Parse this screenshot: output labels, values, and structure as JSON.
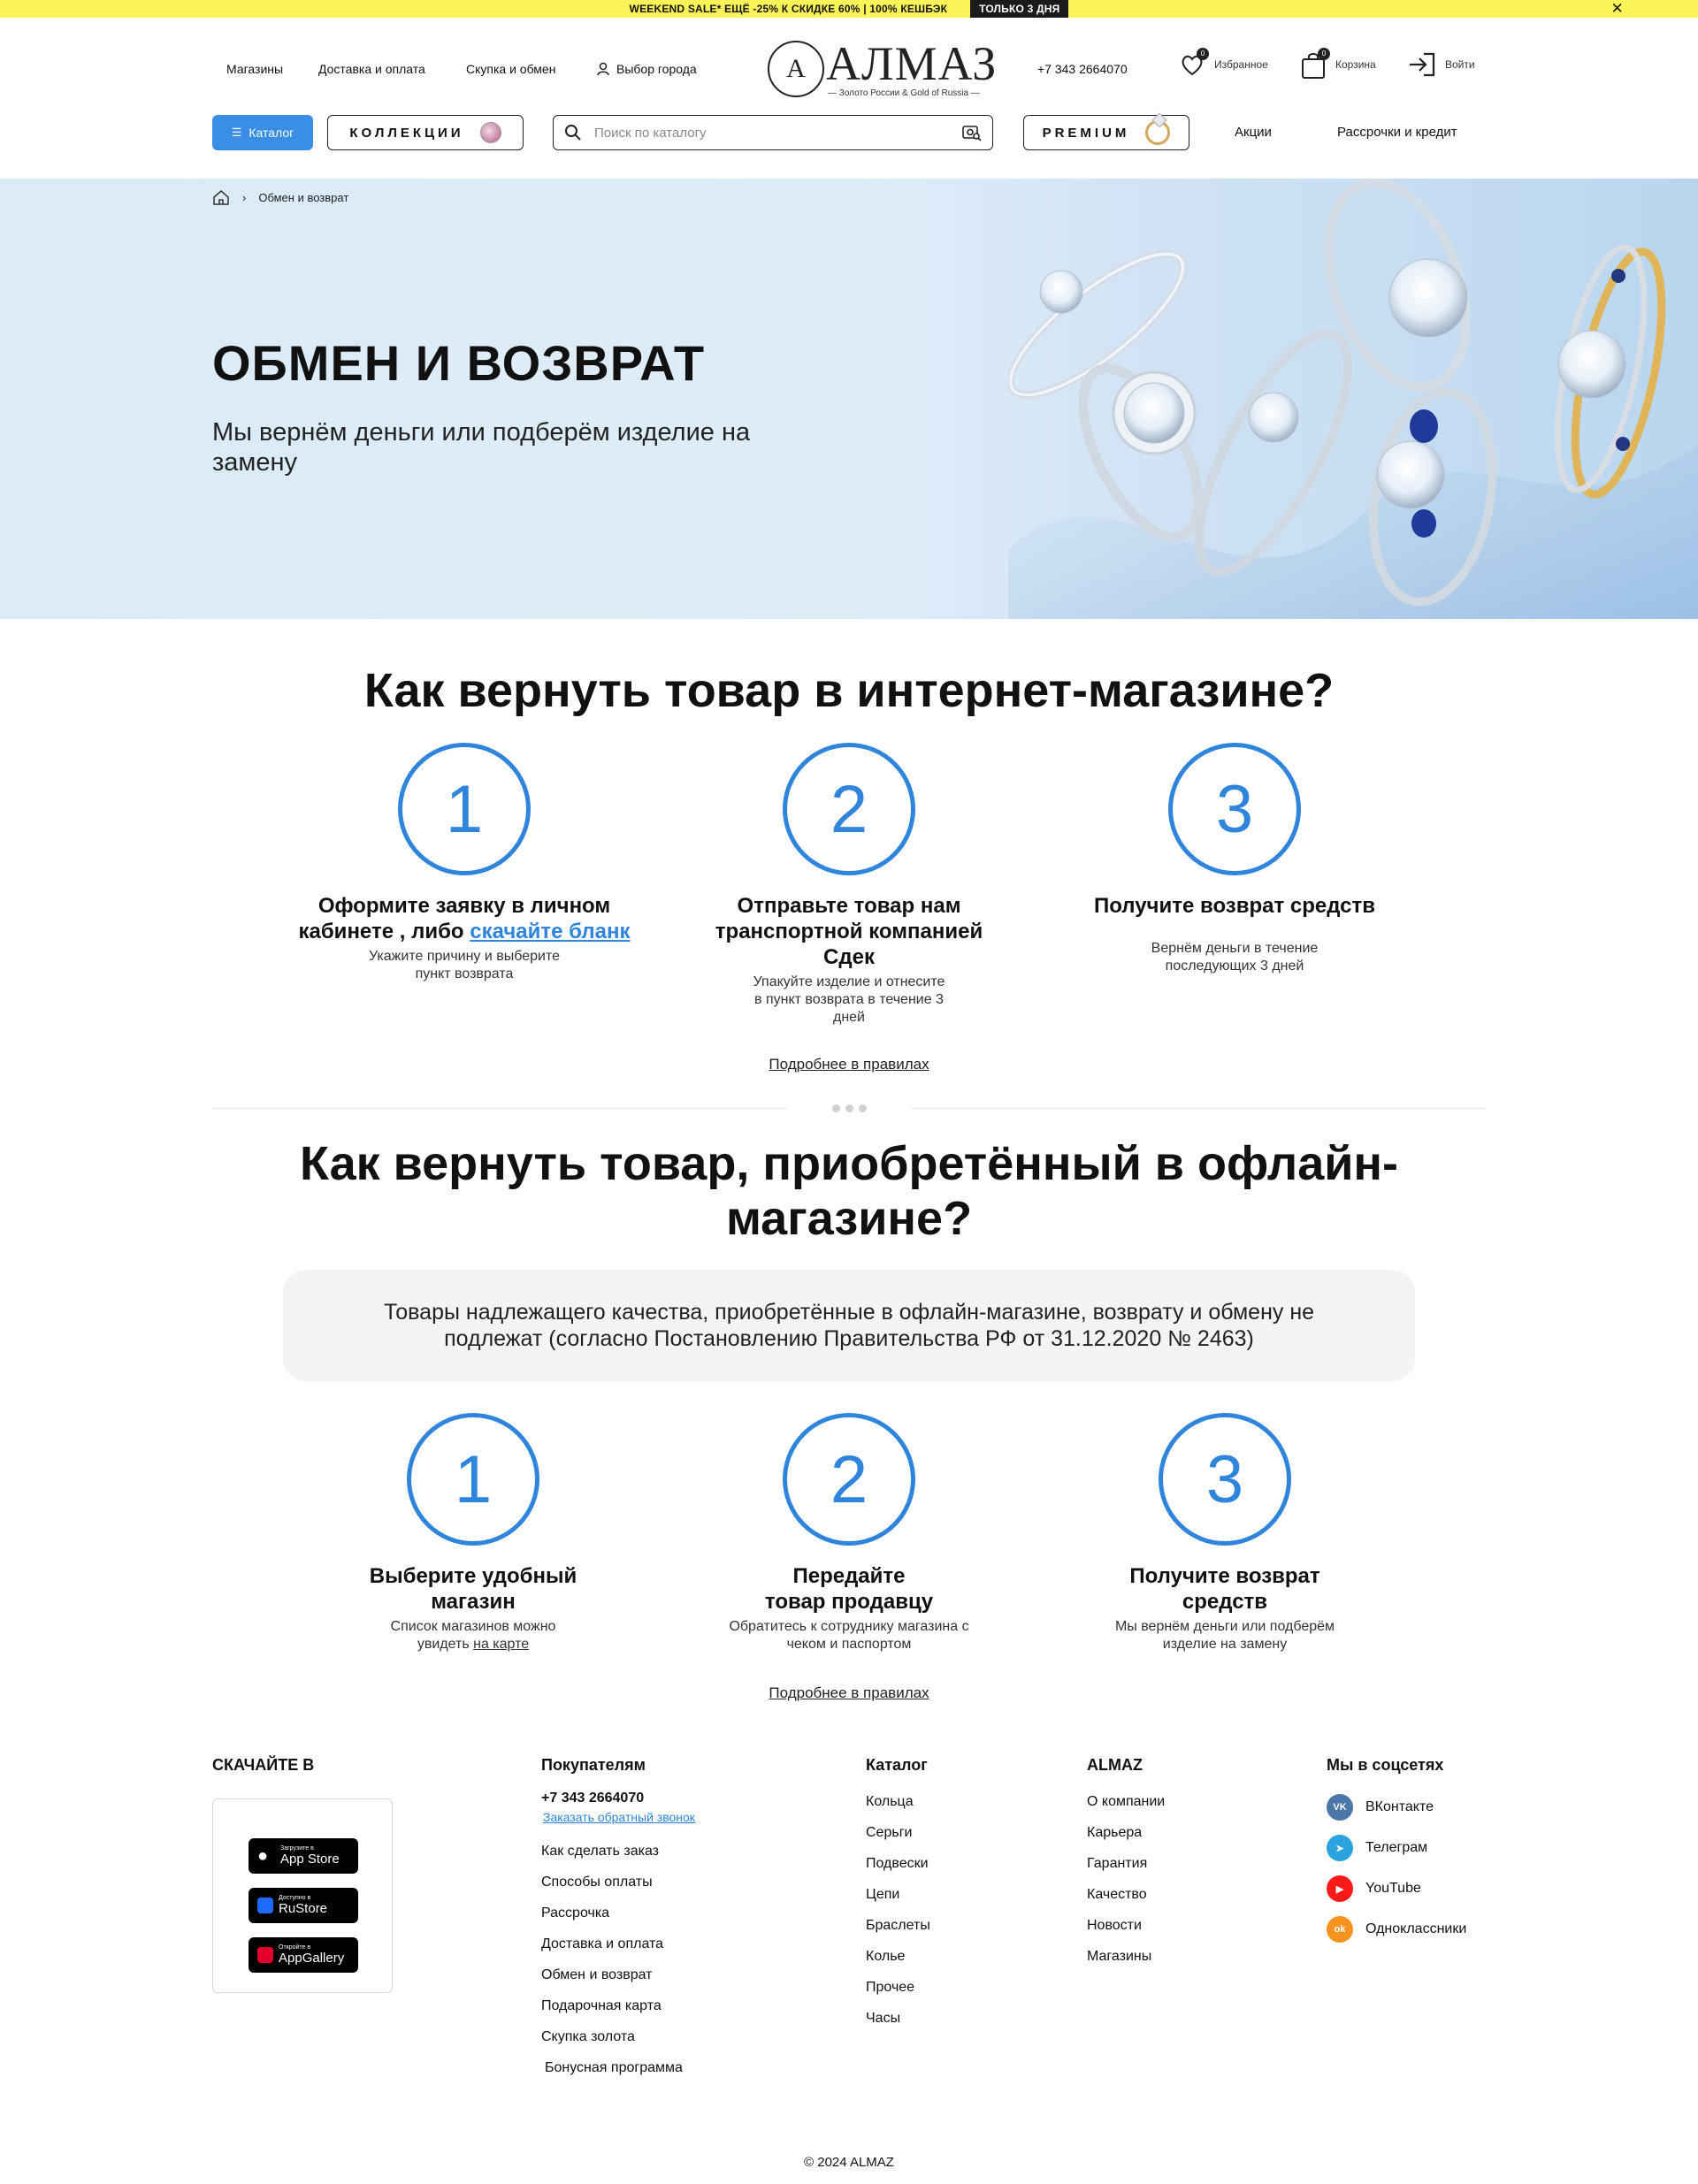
{
  "promo": {
    "text": "WEEKEND SALE* ЕЩЁ -25% К СКИДКЕ 60% | 100% КЕШБЭК",
    "badge": "ТОЛЬКО 3 ДНЯ",
    "close_icon": "close-icon"
  },
  "header": {
    "nav": [
      "Магазины",
      "Доставка и оплата",
      "Скупка и обмен",
      "Выбор города"
    ],
    "logo_text": "АЛМАЗ",
    "logo_tagline": "— Золото России & Gold of Russia —",
    "phone": "+7 343 2664070",
    "favorites_label": "Избранное",
    "favorites_count": "0",
    "cart_label": "Корзина",
    "cart_count": "0",
    "login_label": "Войти"
  },
  "toolbar": {
    "catalog_label": "Каталог",
    "collections_label": "КОЛЛЕКЦИИ",
    "search_placeholder": "Поиск по каталогу",
    "premium_label": "PREMIUM",
    "promo_link": "Акции",
    "credit_link": "Рассрочки и кредит"
  },
  "hero": {
    "breadcrumb_current": "Обмен и возврат",
    "title": "ОБМЕН И ВОЗВРАТ",
    "subtitle": "Мы вернём деньги или подберём изделие на замену"
  },
  "online": {
    "title": "Как вернуть товар в интернет-магазине?",
    "steps": [
      {
        "num": "1",
        "title_before": "Оформите заявку в личном кабинете , либо ",
        "title_link": "скачайте бланк",
        "text": "Укажите причину и выберите пункт возврата"
      },
      {
        "num": "2",
        "title": "Отправьте товар нам транспортной компанией Сдек",
        "text": "Упакуйте изделие и отнесите в пункт возврата в течение 3 дней"
      },
      {
        "num": "3",
        "title": "Получите возврат средств",
        "text": "Вернём деньги в течение последующих 3 дней"
      }
    ],
    "more": "Подробнее в правилах"
  },
  "offline": {
    "title": "Как вернуть товар, приобретённый в офлайн-магазине?",
    "note": "Товары надлежащего качества, приобретённые в офлайн-магазине, возврату и обмену не подлежат (согласно Постановлению Правительства РФ от 31.12.2020 № 2463)",
    "steps": [
      {
        "num": "1",
        "title": "Выберите удобный магазин",
        "text_before": "Список магазинов можно увидеть ",
        "text_link": "на карте"
      },
      {
        "num": "2",
        "title": "Передайте товар продавцу",
        "text": "Обратитесь к сотруднику магазина с чеком и паспортом"
      },
      {
        "num": "3",
        "title": "Получите возврат средств",
        "text": "Мы вернём деньги или подберём изделие на замену"
      }
    ],
    "more": "Подробнее в правилах"
  },
  "footer": {
    "download_title": "СКАЧАЙТЕ В",
    "stores": [
      {
        "small": "Загрузите в",
        "big": "App Store",
        "icon": "apple-icon"
      },
      {
        "small": "Доступно в",
        "big": "RuStore",
        "icon": "rustore-icon"
      },
      {
        "small": "Откройте в",
        "big": "AppGallery",
        "icon": "huawei-icon"
      }
    ],
    "buyers": {
      "title": "Покупателям",
      "phone": "+7 343 2664070",
      "callback": "Заказать обратный звонок",
      "links": [
        "Как сделать заказ",
        "Способы оплаты",
        "Рассрочка",
        "Доставка и оплата",
        "Обмен и возврат",
        "Подарочная карта",
        "Скупка золота",
        "Бонусная программа"
      ]
    },
    "catalog": {
      "title": "Каталог",
      "links": [
        "Кольца",
        "Серьги",
        "Подвески",
        "Цепи",
        "Браслеты",
        "Колье",
        "Прочее",
        "Часы"
      ]
    },
    "almaz": {
      "title": "ALMAZ",
      "links": [
        "О компании",
        "Карьера",
        "Гарантия",
        "Качество",
        "Новости",
        "Магазины"
      ]
    },
    "social": {
      "title": "Мы в соцсетях",
      "links": [
        {
          "label": "ВКонтакте",
          "icon": "vk-icon",
          "color": "#4a76a8",
          "glyph": "VK"
        },
        {
          "label": "Телеграм",
          "icon": "telegram-icon",
          "color": "#2aa3de",
          "glyph": "➤"
        },
        {
          "label": "YouTube",
          "icon": "youtube-icon",
          "color": "#ff1a1a",
          "glyph": "▶"
        },
        {
          "label": "Одноклассники",
          "icon": "odnoklassniki-icon",
          "color": "#f7931e",
          "glyph": "ok"
        }
      ]
    },
    "copyright": "© 2024 ALMAZ"
  },
  "colors": {
    "accent": "#2f85dc",
    "catalog_button": "#3a8ee6",
    "promo_bar": "#fbf55a"
  }
}
